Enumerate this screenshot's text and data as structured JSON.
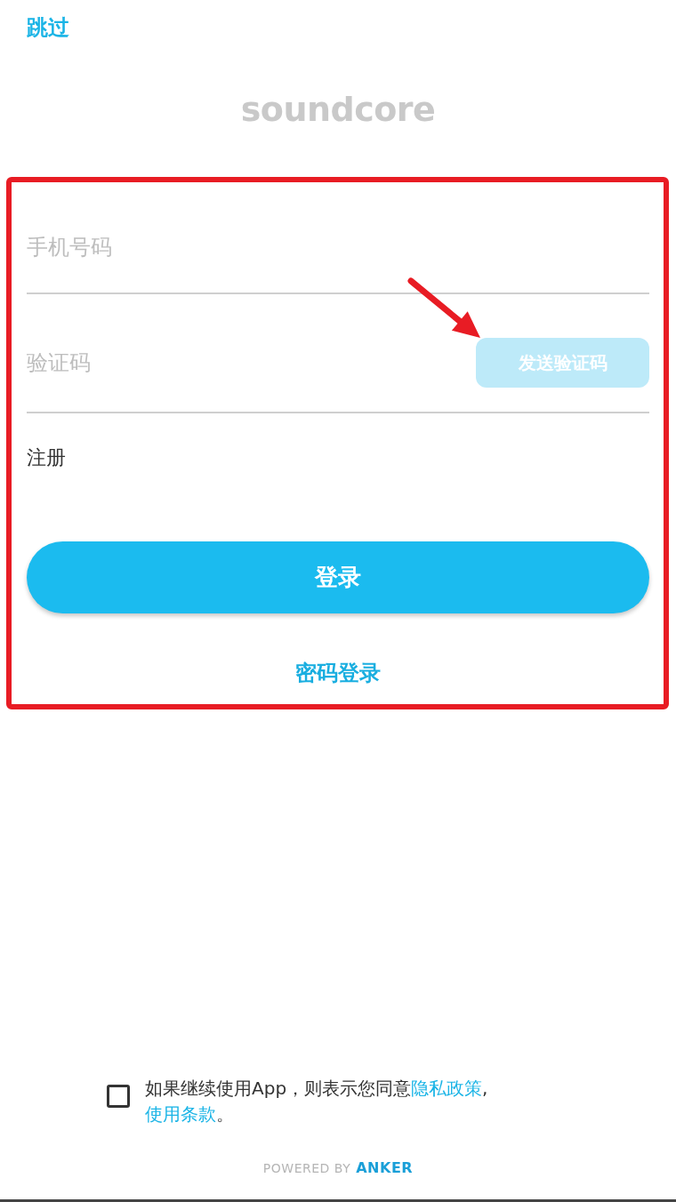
{
  "skip": "跳过",
  "logo": "soundcore",
  "form": {
    "phone": {
      "placeholder": "手机号码"
    },
    "code": {
      "placeholder": "验证码",
      "send_button": {
        "label": "发送验证码",
        "disabled": true
      }
    },
    "register_link": "注册",
    "login_button": "登录",
    "password_login_link": "密码登录"
  },
  "agreement": {
    "checked": false,
    "parts": [
      {
        "kind": "text",
        "text": "如果继续使用App，则表示您同意"
      },
      {
        "kind": "link",
        "text": "隐私政策"
      },
      {
        "kind": "text",
        "text": ","
      },
      {
        "kind": "link",
        "text": "使用条款"
      },
      {
        "kind": "text",
        "text": "。"
      }
    ]
  },
  "footer": {
    "powered_by": "POWERED BY",
    "brand": "ANKER"
  },
  "annotations": {
    "highlight_frame": true,
    "arrow": true
  }
}
